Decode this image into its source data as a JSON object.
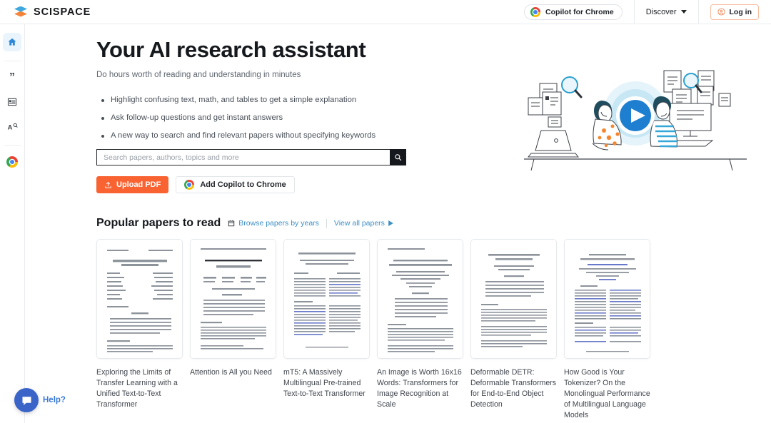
{
  "brand": {
    "name": "SCISPACE",
    "logo_icon": "stacked-layers-logo",
    "top_color": "#3fa8dc",
    "bottom_color": "#f2843c"
  },
  "header": {
    "copilot_chip": {
      "label": "Copilot for Chrome",
      "icon": "chrome-icon"
    },
    "discover": {
      "label": "Discover",
      "icon": "chevron-down-icon"
    },
    "login": {
      "label": "Log in",
      "icon": "user-circle-icon",
      "border_color": "#f7bda1"
    }
  },
  "sidebar": {
    "items": [
      {
        "name": "home",
        "icon": "home-icon",
        "active": true
      },
      {
        "name": "citation",
        "icon": "quote-icon",
        "active": false
      },
      {
        "name": "literature-review",
        "icon": "list-icon",
        "active": false
      },
      {
        "name": "paraphraser",
        "icon": "paraphrase-a-icon",
        "active": false
      },
      {
        "name": "chrome-extension",
        "icon": "chrome-icon",
        "active": false
      }
    ]
  },
  "hero": {
    "title": "Your AI research assistant",
    "subtitle": "Do hours worth of reading and understanding in minutes",
    "bullets": [
      "Highlight confusing text, math, and tables to get a simple explanation",
      "Ask follow-up questions and get instant answers",
      "A new way to search and find relevant papers without specifying keywords"
    ],
    "illustration": "two-people-at-computers-with-papers-and-play-button"
  },
  "search": {
    "placeholder": "Search papers, authors, topics and more",
    "value": "",
    "button_icon": "search-icon"
  },
  "actions": {
    "upload": {
      "label": "Upload PDF",
      "icon": "upload-icon",
      "color": "#f96332"
    },
    "add_copilot": {
      "label": "Add Copilot to Chrome",
      "icon": "chrome-icon"
    }
  },
  "popular": {
    "title": "Popular papers to read",
    "browse_link": {
      "label": "Browse papers by years",
      "icon": "calendar-icon"
    },
    "view_all_link": {
      "label": "View all papers",
      "icon": "play-triangle-icon"
    },
    "link_color": "#3e8fc4",
    "papers": [
      {
        "title": "Exploring the Limits of Transfer Learning with a Unified Text-to-Text Transformer",
        "thumb": "paper-page-scan"
      },
      {
        "title": "Attention is All you Need",
        "thumb": "paper-page-scan"
      },
      {
        "title": "mT5: A Massively Multilingual Pre-trained Text-to-Text Transformer",
        "thumb": "paper-page-scan"
      },
      {
        "title": "An Image is Worth 16x16 Words: Transformers for Image Recognition at Scale",
        "thumb": "paper-page-scan"
      },
      {
        "title": "Deformable DETR: Deformable Transformers for End-to-End Object Detection",
        "thumb": "paper-page-scan"
      },
      {
        "title": "How Good is Your Tokenizer? On the Monolingual Performance of Multilingual Language Models",
        "thumb": "paper-page-scan"
      }
    ]
  },
  "help": {
    "label": "Help?",
    "icon": "chat-bubble-icon",
    "color": "#3a64c8"
  }
}
